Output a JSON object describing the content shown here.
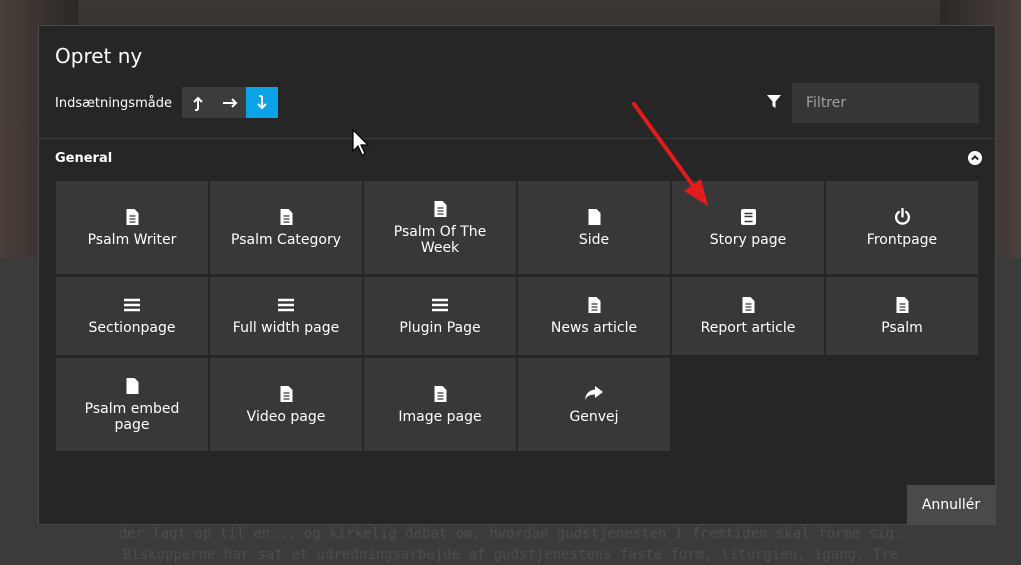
{
  "modal": {
    "title": "Opret ny",
    "insert_mode_label": "Indsætningsmåde",
    "insert_modes": [
      "insert-before",
      "insert-after",
      "insert-inside"
    ],
    "active_mode": "insert-inside",
    "filter_placeholder": "Filtrer",
    "section_title": "General",
    "cancel_label": "Annullér",
    "accent_color": "#0aa3e6"
  },
  "tiles": [
    {
      "label": "Psalm Writer",
      "icon": "file-text-icon"
    },
    {
      "label": "Psalm Category",
      "icon": "file-text-icon"
    },
    {
      "label": "Psalm Of The Week",
      "icon": "file-text-icon"
    },
    {
      "label": "Side",
      "icon": "file-icon"
    },
    {
      "label": "Story page",
      "icon": "book-icon"
    },
    {
      "label": "Frontpage",
      "icon": "power-icon"
    },
    {
      "label": "Sectionpage",
      "icon": "bars-icon"
    },
    {
      "label": "Full width page",
      "icon": "bars-icon"
    },
    {
      "label": "Plugin Page",
      "icon": "bars-icon"
    },
    {
      "label": "News article",
      "icon": "file-text-icon"
    },
    {
      "label": "Report article",
      "icon": "file-text-icon"
    },
    {
      "label": "Psalm",
      "icon": "file-text-icon"
    },
    {
      "label": "Psalm embed page",
      "icon": "file-icon"
    },
    {
      "label": "Video page",
      "icon": "file-text-icon"
    },
    {
      "label": "Image page",
      "icon": "file-text-icon"
    },
    {
      "label": "Genvej",
      "icon": "share-icon"
    }
  ],
  "background": {
    "line1": "der lagt op til en... og kirkelig debat om, hvordan gudstjenesten i fremtiden skal forme sig.",
    "line2": "Biskopperne har sat et udredningsarbejde af gudstjenestens faste form, liturgien, igang. Tre"
  }
}
